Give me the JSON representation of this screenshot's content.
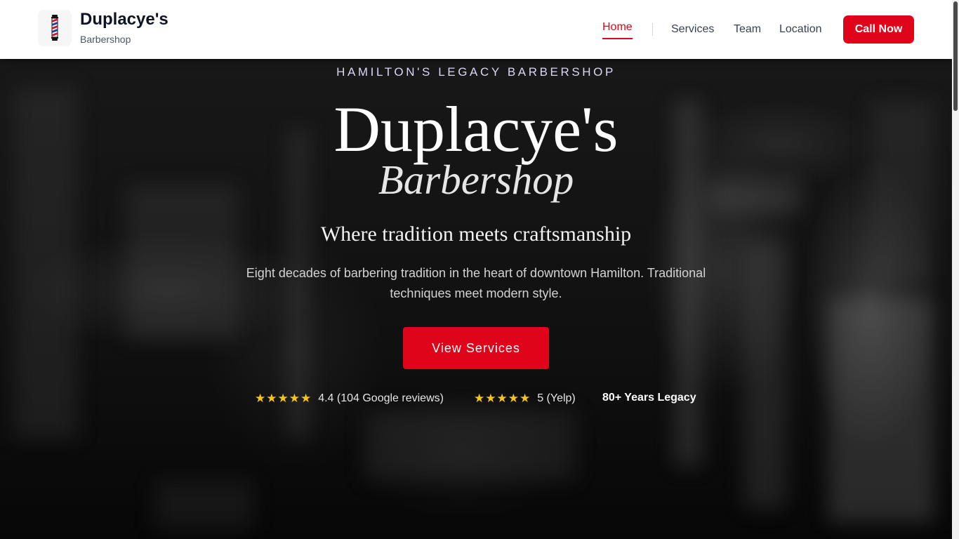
{
  "header": {
    "brand_title": "Duplacye's",
    "brand_subtitle": "Barbershop",
    "logo_icon": "barber-pole-icon",
    "nav": {
      "home": "Home",
      "services": "Services",
      "team": "Team",
      "location": "Location"
    },
    "cta_label": "Call Now",
    "active_color": "#dc0a1a"
  },
  "hero": {
    "eyebrow": "HAMILTON'S LEGACY BARBERSHOP",
    "title": "Duplacye's",
    "title_sub": "Barbershop",
    "tagline": "Where tradition meets craftsmanship",
    "description": "Eight decades of barbering tradition in the heart of downtown Hamilton. Traditional techniques meet modern style.",
    "cta_label": "View Services",
    "ratings": [
      {
        "stars": "★★★★★",
        "text": "4.4 (104 Google reviews)"
      },
      {
        "stars": "★★★★★",
        "text": "5 (Yelp)"
      }
    ],
    "legacy": "80+ Years Legacy",
    "accent_color": "#e0041a",
    "star_color": "#f5c518"
  }
}
